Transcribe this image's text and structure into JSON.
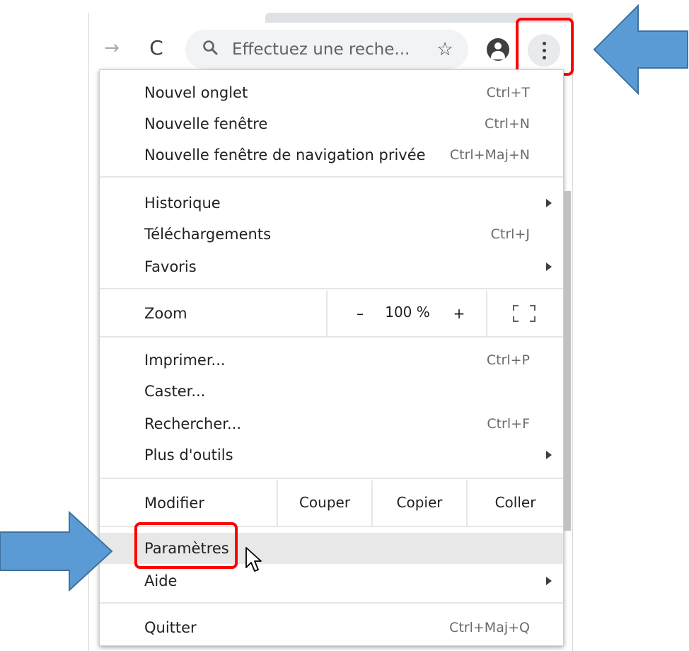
{
  "toolbar": {
    "search_placeholder": "Effectuez une reche...",
    "forward_glyph": "→",
    "reload_glyph": "C",
    "search_glyph": "🔍",
    "star_glyph": "☆"
  },
  "menu": {
    "group1": [
      {
        "label": "Nouvel onglet",
        "shortcut": "Ctrl+T"
      },
      {
        "label": "Nouvelle fenêtre",
        "shortcut": "Ctrl+N"
      },
      {
        "label": "Nouvelle fenêtre de navigation privée",
        "shortcut": "Ctrl+Maj+N"
      }
    ],
    "group2": [
      {
        "label": "Historique",
        "submenu": true
      },
      {
        "label": "Téléchargements",
        "shortcut": "Ctrl+J"
      },
      {
        "label": "Favoris",
        "submenu": true
      }
    ],
    "zoom": {
      "label": "Zoom",
      "minus": "–",
      "value": "100 %",
      "plus": "+"
    },
    "group3": [
      {
        "label": "Imprimer...",
        "shortcut": "Ctrl+P"
      },
      {
        "label": "Caster..."
      },
      {
        "label": "Rechercher...",
        "shortcut": "Ctrl+F"
      },
      {
        "label": "Plus d'outils",
        "submenu": true
      }
    ],
    "edit": {
      "label": "Modifier",
      "cut": "Couper",
      "copy": "Copier",
      "paste": "Coller"
    },
    "group4": [
      {
        "label": "Paramètres",
        "highlighted": true
      },
      {
        "label": "Aide",
        "submenu": true
      }
    ],
    "quit": {
      "label": "Quitter",
      "shortcut": "Ctrl+Maj+Q"
    }
  },
  "icons": {
    "forward": "arrow-forward-icon",
    "reload": "reload-icon",
    "search": "search-icon",
    "star": "star-icon",
    "account": "account-icon",
    "menu": "three-dots-vertical-icon",
    "fullscreen": "fullscreen-icon",
    "cursor": "mouse-pointer-icon"
  },
  "colors": {
    "highlight_box": "#ff0000",
    "annotation_arrow": "#5b9bd5",
    "hover_row": "#e8e8e8"
  }
}
